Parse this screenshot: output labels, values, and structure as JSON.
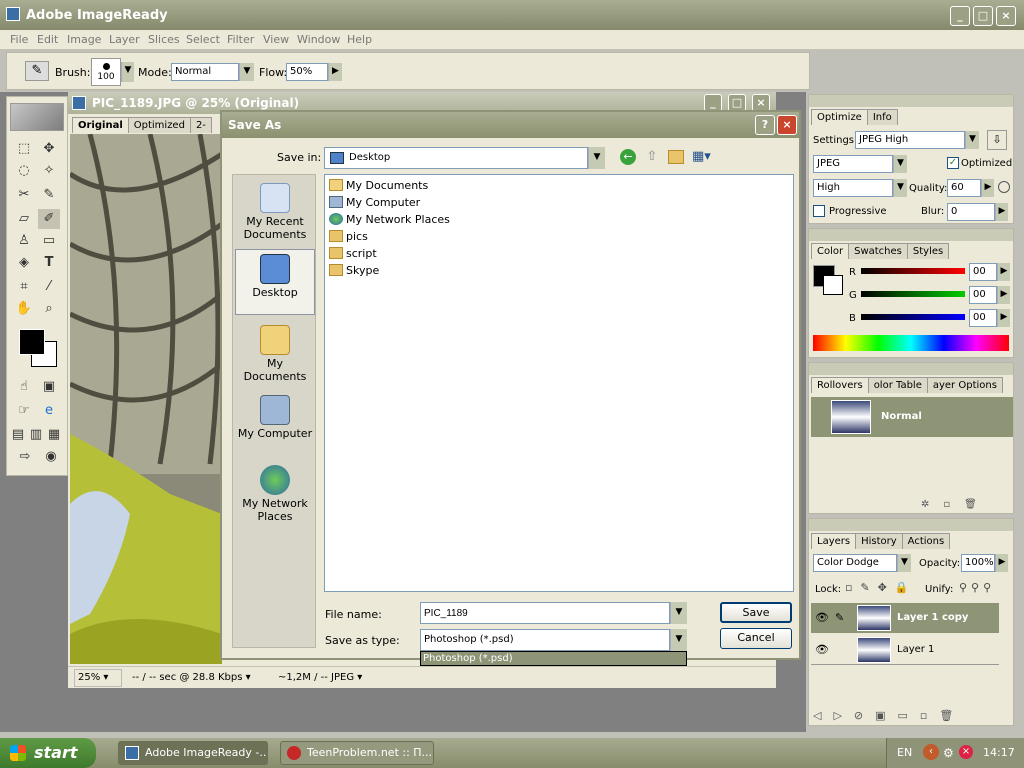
{
  "app": {
    "title": "Adobe ImageReady"
  },
  "menu": [
    "File",
    "Edit",
    "Image",
    "Layer",
    "Slices",
    "Select",
    "Filter",
    "View",
    "Window",
    "Help"
  ],
  "options": {
    "brush_label": "Brush:",
    "brush_size": "100",
    "mode_label": "Mode:",
    "mode_value": "Normal",
    "flow_label": "Flow:",
    "flow_value": "50%"
  },
  "document": {
    "title": "PIC_1189.JPG @ 25% (Original)",
    "tabs": [
      "Original",
      "Optimized",
      "2-"
    ],
    "zoom": "25%",
    "speed": "-- / -- sec @ 28.8 Kbps",
    "size": "~1,2M / -- JPEG"
  },
  "dialog": {
    "title": "Save As",
    "save_in_label": "Save in:",
    "save_in_value": "Desktop",
    "places": [
      "My Recent Documents",
      "Desktop",
      "My Documents",
      "My Computer",
      "My Network Places"
    ],
    "files": [
      {
        "name": "My Documents",
        "icon": "my-documents-icon"
      },
      {
        "name": "My Computer",
        "icon": "my-computer-icon"
      },
      {
        "name": "My Network Places",
        "icon": "network-places-icon"
      },
      {
        "name": "pics",
        "icon": "folder-icon"
      },
      {
        "name": "script",
        "icon": "folder-icon"
      },
      {
        "name": "Skype",
        "icon": "folder-icon"
      }
    ],
    "filename_label": "File name:",
    "filename_value": "PIC_1189",
    "type_label": "Save as type:",
    "type_value": "Photoshop (*.psd)",
    "type_option": "Photoshop (*.psd)",
    "save_button": "Save",
    "cancel_button": "Cancel"
  },
  "optimize": {
    "tabs": [
      "Optimize",
      "Info"
    ],
    "settings_label": "Settings:",
    "settings_value": "JPEG High",
    "format": "JPEG",
    "optimized_label": "Optimized",
    "quality_preset": "High",
    "quality_label": "Quality:",
    "quality_value": "60",
    "progressive_label": "Progressive",
    "blur_label": "Blur:",
    "blur_value": "0"
  },
  "color": {
    "tabs": [
      "Color",
      "Swatches",
      "Styles"
    ],
    "r_label": "R",
    "g_label": "G",
    "b_label": "B",
    "r": "00",
    "g": "00",
    "b": "00"
  },
  "rollovers": {
    "tabs": [
      "Rollovers",
      "olor Table",
      "ayer Options"
    ],
    "state": "Normal"
  },
  "layers": {
    "tabs": [
      "Layers",
      "History",
      "Actions"
    ],
    "blend": "Color Dodge",
    "opacity_label": "Opacity:",
    "opacity": "100%",
    "lock_label": "Lock:",
    "unify_label": "Unify:",
    "items": [
      "Layer 1 copy",
      "Layer 1"
    ]
  },
  "taskbar": {
    "start": "start",
    "tasks": [
      "Adobe ImageReady -...",
      "TeenProblem.net :: П..."
    ],
    "lang": "EN",
    "time": "14:17"
  },
  "colors": {
    "accent": "#8e9476",
    "selection": "#9ca084",
    "title_green": "#a9ad92"
  }
}
